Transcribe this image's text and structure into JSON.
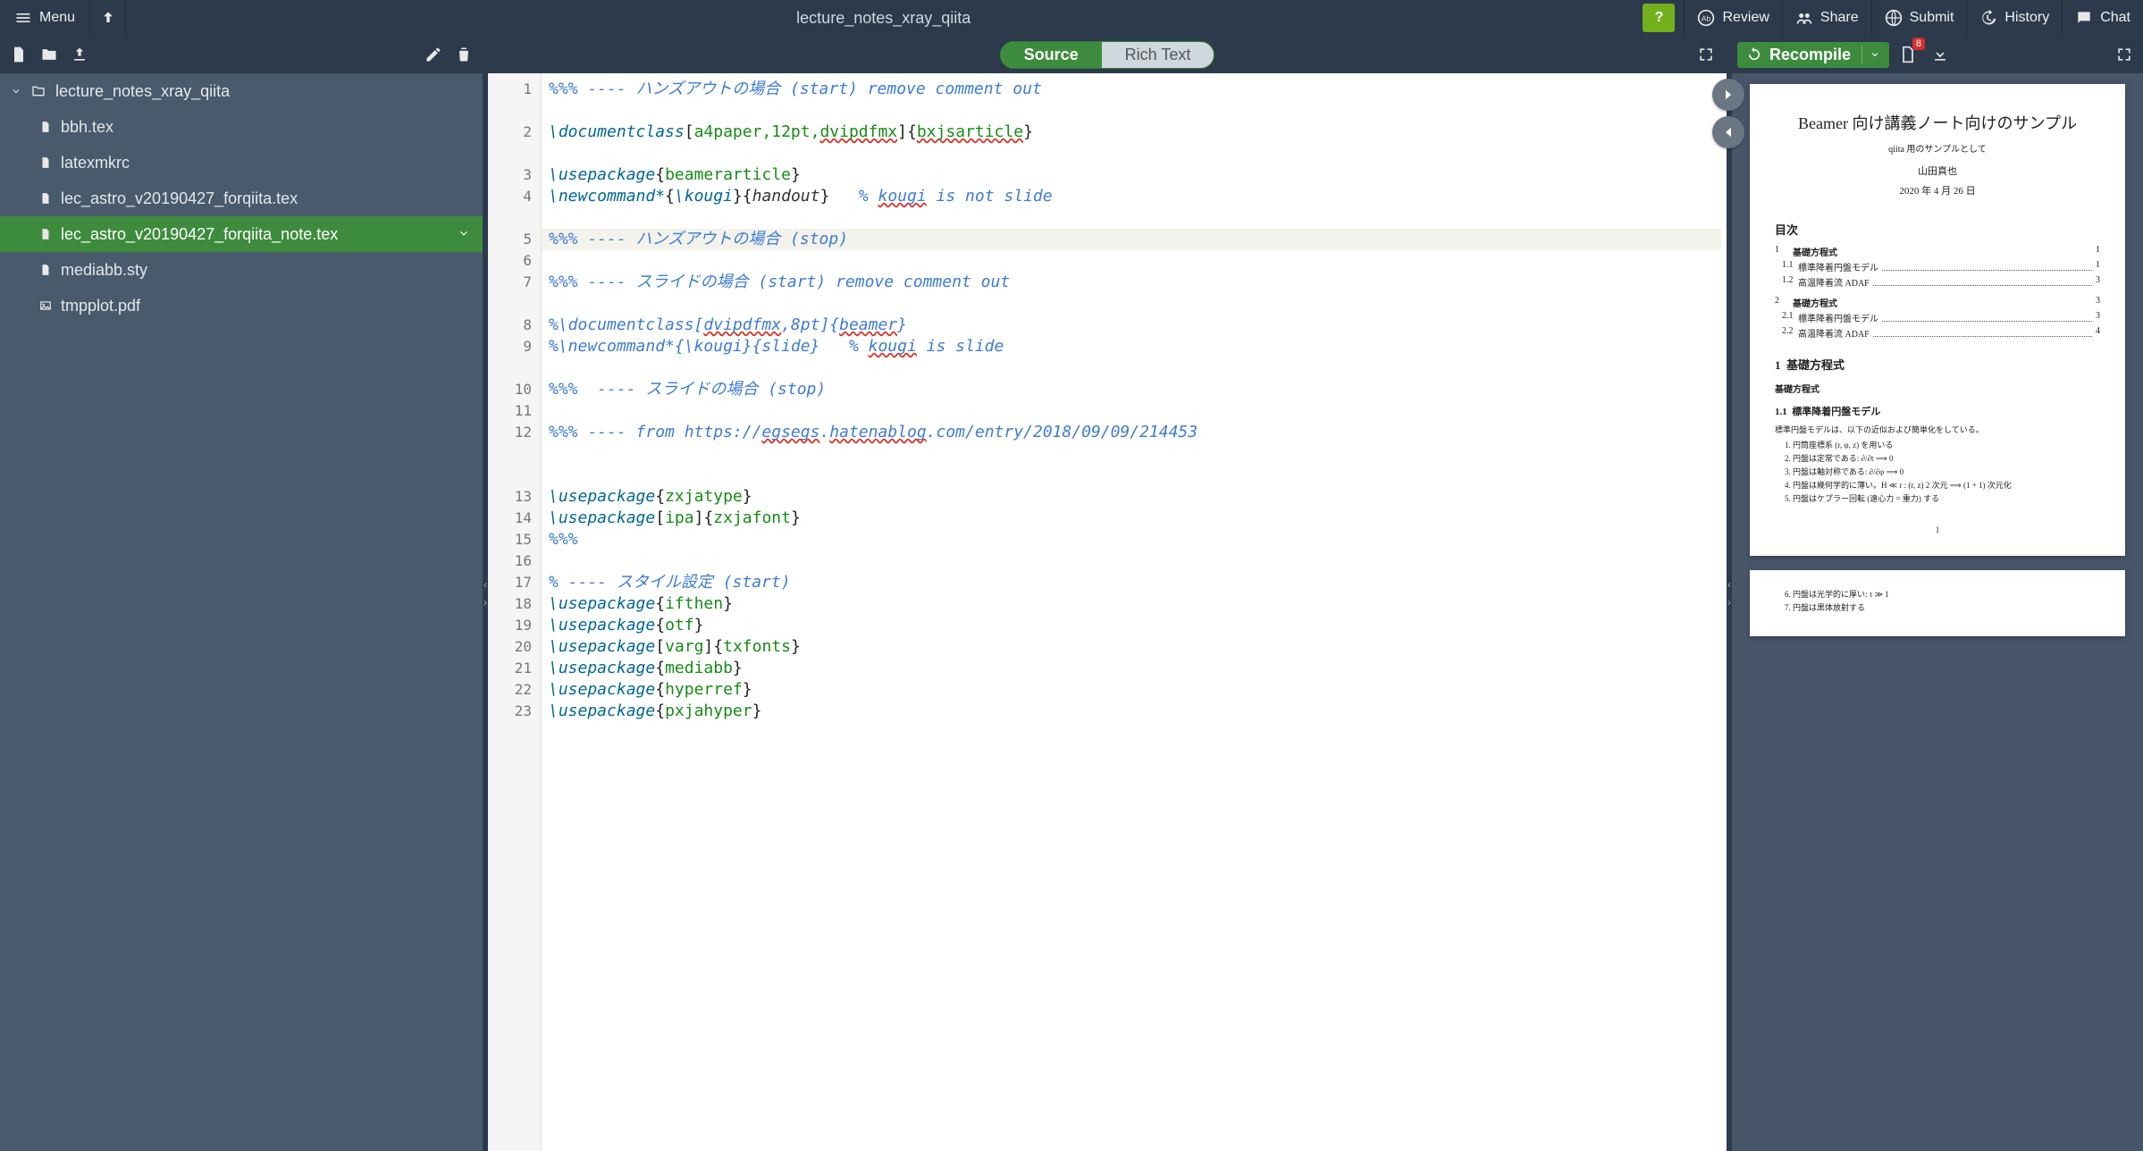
{
  "topbar": {
    "menu_label": "Menu",
    "project_title": "lecture_notes_xray_qiita",
    "help_label": "?",
    "review_label": "Review",
    "share_label": "Share",
    "submit_label": "Submit",
    "history_label": "History",
    "chat_label": "Chat"
  },
  "filetree": {
    "root": "lecture_notes_xray_qiita",
    "files": [
      {
        "name": "bbh.tex",
        "kind": "tex"
      },
      {
        "name": "latexmkrc",
        "kind": "file"
      },
      {
        "name": "lec_astro_v20190427_forqiita.tex",
        "kind": "tex"
      },
      {
        "name": "lec_astro_v20190427_forqiita_note.tex",
        "kind": "tex",
        "active": true
      },
      {
        "name": "mediabb.sty",
        "kind": "file"
      },
      {
        "name": "tmpplot.pdf",
        "kind": "image"
      }
    ]
  },
  "editor": {
    "tab_source": "Source",
    "tab_rich": "Rich Text",
    "lines": [
      {
        "n": 1,
        "h": 2,
        "html": "<span class='c-cmt'>%%% ---- ハンズアウトの場合 (start) remove comment out</span>"
      },
      {
        "n": 2,
        "h": 2,
        "html": "<span class='c-cmd'>\\documentclass</span><span class='c-brace'>[</span><span class='c-arg'>a4paper,12pt,<span class='spell'>dvipdfmx</span></span><span class='c-brace'>]{</span><span class='c-arg spell'>bxjsarticle</span><span class='c-brace'>}</span>"
      },
      {
        "n": 3,
        "h": 1,
        "html": "<span class='c-cmd'>\\usepackage</span><span class='c-brace'>{</span><span class='c-arg'>beamerarticle</span><span class='c-brace'>}</span>"
      },
      {
        "n": 4,
        "h": 2,
        "html": "<span class='c-cmd'>\\newcommand*</span><span class='c-brace'>{</span><span class='c-cmd'>\\kougi</span><span class='c-brace'>}{</span>handout<span class='c-brace'>}</span>&nbsp;&nbsp;&nbsp;<span class='c-cmt'>% <span class='spell'>kougi</span> is not slide</span>"
      },
      {
        "n": 5,
        "h": 1,
        "hl": true,
        "html": "<span class='c-cmt'>%%% ---- </span><span class='c-cmt'>ハンズアウトの場合 (stop)</span>"
      },
      {
        "n": 6,
        "h": 1,
        "html": ""
      },
      {
        "n": 7,
        "h": 2,
        "html": "<span class='c-cmt'>%%% ---- スライドの場合 (start) remove comment out</span>"
      },
      {
        "n": 8,
        "h": 1,
        "html": "<span class='c-cmt'>%\\documentclass[<span class='spell'>dvipdfmx</span>,8pt]{<span class='spell'>beamer</span>}</span>"
      },
      {
        "n": 9,
        "h": 2,
        "html": "<span class='c-cmt'>%\\newcommand*{\\kougi}{slide}&nbsp;&nbsp;&nbsp;% <span class='spell'>kougi</span> is slide</span>"
      },
      {
        "n": 10,
        "h": 1,
        "html": "<span class='c-cmt'>%%%&nbsp;&nbsp;---- スライドの場合 (stop)</span>"
      },
      {
        "n": 11,
        "h": 1,
        "html": ""
      },
      {
        "n": 12,
        "h": 3,
        "html": "<span class='c-cmt'>%%% ---- from https://<span class='spell'>egsegs</span>.<span class='spell'>hatenablog</span>.com/entry/2018/09/09/214453</span>"
      },
      {
        "n": 13,
        "h": 1,
        "html": "<span class='c-cmd'>\\usepackage</span><span class='c-brace'>{</span><span class='c-arg'>zxjatype</span><span class='c-brace'>}</span>"
      },
      {
        "n": 14,
        "h": 1,
        "html": "<span class='c-cmd'>\\usepackage</span><span class='c-brace'>[</span><span class='c-arg'>ipa</span><span class='c-brace'>]{</span><span class='c-arg'>zxjafont</span><span class='c-brace'>}</span>"
      },
      {
        "n": 15,
        "h": 1,
        "html": "<span class='c-cmt'>%%%</span>"
      },
      {
        "n": 16,
        "h": 1,
        "html": ""
      },
      {
        "n": 17,
        "h": 1,
        "html": "<span class='c-cmt'>% ---- スタイル設定 (start)</span>"
      },
      {
        "n": 18,
        "h": 1,
        "html": "<span class='c-cmd'>\\usepackage</span><span class='c-brace'>{</span><span class='c-arg'>ifthen</span><span class='c-brace'>}</span>"
      },
      {
        "n": 19,
        "h": 1,
        "html": "<span class='c-cmd'>\\usepackage</span><span class='c-brace'>{</span><span class='c-arg'>otf</span><span class='c-brace'>}</span>"
      },
      {
        "n": 20,
        "h": 1,
        "html": "<span class='c-cmd'>\\usepackage</span><span class='c-brace'>[</span><span class='c-arg'>varg</span><span class='c-brace'>]{</span><span class='c-arg'>txfonts</span><span class='c-brace'>}</span>"
      },
      {
        "n": 21,
        "h": 1,
        "html": "<span class='c-cmd'>\\usepackage</span><span class='c-brace'>{</span><span class='c-arg'>mediabb</span><span class='c-brace'>}</span>"
      },
      {
        "n": 22,
        "h": 1,
        "html": "<span class='c-cmd'>\\usepackage</span><span class='c-brace'>{</span><span class='c-arg'>hyperref</span><span class='c-brace'>}</span>"
      },
      {
        "n": 23,
        "h": 1,
        "html": "<span class='c-cmd'>\\usepackage</span><span class='c-brace'>{</span><span class='c-arg'>pxjahyper</span><span class='c-brace'>}</span>"
      }
    ]
  },
  "rightbar": {
    "recompile_label": "Recompile",
    "log_badge": "8"
  },
  "pdf": {
    "title": "Beamer 向け講義ノート向けのサンプル",
    "subtitle": "qiita 用のサンプルとして",
    "author": "山田真也",
    "date": "2020 年 4 月 26 日",
    "toc_label": "目次",
    "toc": [
      {
        "num": "1",
        "title": "基礎方程式",
        "page": "1",
        "bold": true
      },
      {
        "num": "1.1",
        "title": "標準降着円盤モデル",
        "page": "1"
      },
      {
        "num": "1.2",
        "title": "高温降着流 ADAF",
        "page": "3"
      },
      {
        "num": "2",
        "title": "基礎方程式",
        "page": "3",
        "bold": true,
        "gap": true
      },
      {
        "num": "2.1",
        "title": "標準降着円盤モデル",
        "page": "3"
      },
      {
        "num": "2.2",
        "title": "高温降着流 ADAF",
        "page": "4"
      }
    ],
    "sec1_num": "1",
    "sec1_title": "基礎方程式",
    "sec1_mini": "基礎方程式",
    "subsec11_num": "1.1",
    "subsec11_title": "標準降着円盤モデル",
    "body_intro": "標準円盤モデルは、以下の近似および簡単化をしている。",
    "assumptions_p1": [
      "円筒座標系 (r, φ, z) を用いる",
      "円盤は定常である: ∂/∂t ⟹ 0",
      "円盤は軸対称である: ∂/∂φ ⟹ 0",
      "円盤は幾何学的に薄い。H ≪ r : (r, z) 2 次元 ⟹ (1 + 1) 次元化",
      "円盤はケプラー回転 (遠心力 = 重力) する"
    ],
    "assumptions_p2": [
      "円盤は光学的に厚い: τ ≫ 1",
      "円盤は黒体放射する"
    ],
    "page1_num": "1"
  }
}
